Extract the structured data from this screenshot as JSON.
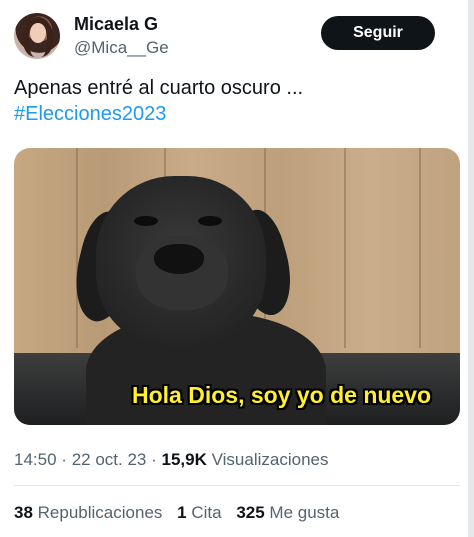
{
  "author": {
    "name": "Micaela G",
    "handle": "@Mica__Ge",
    "follow_label": "Seguir"
  },
  "tweet": {
    "text_line1": "Apenas entré al cuarto oscuro ...",
    "hashtag": "#Elecciones2023"
  },
  "media": {
    "caption": "Hola Dios, soy yo de nuevo"
  },
  "meta": {
    "time": "14:50",
    "separator1": "·",
    "date": "22 oct. 23",
    "separator2": "·",
    "views_count": "15,9K",
    "views_label": "Visualizaciones"
  },
  "stats": {
    "retweets_count": "38",
    "retweets_label": "Republicaciones",
    "quotes_count": "1",
    "quotes_label": "Cita",
    "likes_count": "325",
    "likes_label": "Me gusta"
  },
  "colors": {
    "hashtag": "#1d9bf0",
    "follow_button_bg": "#0f1419",
    "secondary_text": "#536471",
    "caption_text": "#ffef2e"
  }
}
